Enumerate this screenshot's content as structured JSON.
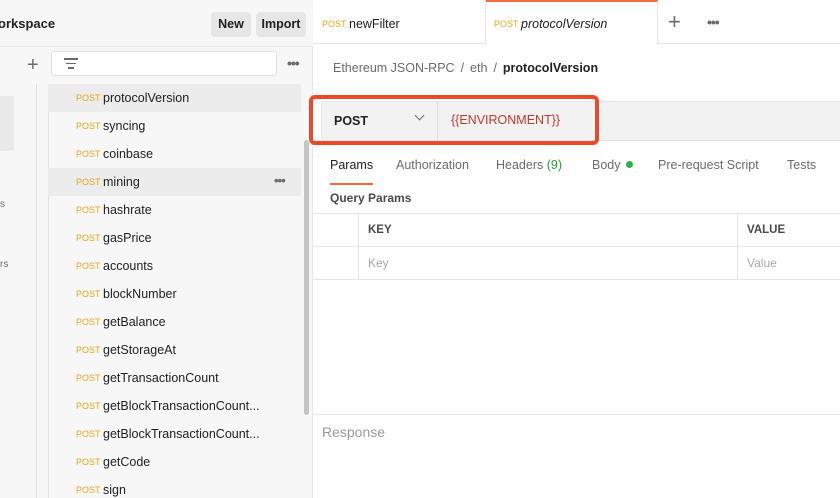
{
  "workspace": {
    "title": "orkspace",
    "new_label": "New",
    "import_label": "Import"
  },
  "rail": {
    "fragments": [
      "s",
      "rs"
    ]
  },
  "sidebar": {
    "requests": [
      {
        "method": "POST",
        "name": "protocolVersion",
        "state": "selected"
      },
      {
        "method": "POST",
        "name": "syncing"
      },
      {
        "method": "POST",
        "name": "coinbase"
      },
      {
        "method": "POST",
        "name": "mining",
        "state": "hovered"
      },
      {
        "method": "POST",
        "name": "hashrate"
      },
      {
        "method": "POST",
        "name": "gasPrice"
      },
      {
        "method": "POST",
        "name": "accounts"
      },
      {
        "method": "POST",
        "name": "blockNumber"
      },
      {
        "method": "POST",
        "name": "getBalance"
      },
      {
        "method": "POST",
        "name": "getStorageAt"
      },
      {
        "method": "POST",
        "name": "getTransactionCount"
      },
      {
        "method": "POST",
        "name": "getBlockTransactionCount..."
      },
      {
        "method": "POST",
        "name": "getBlockTransactionCount..."
      },
      {
        "method": "POST",
        "name": "getCode"
      },
      {
        "method": "POST",
        "name": "sign"
      }
    ]
  },
  "tabs": [
    {
      "method": "POST",
      "name": "newFilter"
    },
    {
      "method": "POST",
      "name": "protocolVersion",
      "active": true
    }
  ],
  "breadcrumb": {
    "collection": "Ethereum JSON-RPC",
    "folder": "eth",
    "request": "protocolVersion",
    "separator": "/"
  },
  "request": {
    "method": "POST",
    "url": "{{ENVIRONMENT}}"
  },
  "request_tabs": {
    "params": "Params",
    "authorization": "Authorization",
    "headers": "Headers",
    "headers_count": "(9)",
    "body": "Body",
    "prerequest": "Pre-request Script",
    "tests": "Tests"
  },
  "query_params": {
    "title": "Query Params",
    "key_header": "KEY",
    "value_header": "VALUE",
    "key_placeholder": "Key",
    "value_placeholder": "Value"
  },
  "response": {
    "label": "Response"
  },
  "colors": {
    "post_method": "#e8a618",
    "accent": "#f26b3a",
    "highlight_box": "#e84a2a",
    "url_variable": "#c0392b",
    "body_indicator": "#2bb34a"
  }
}
